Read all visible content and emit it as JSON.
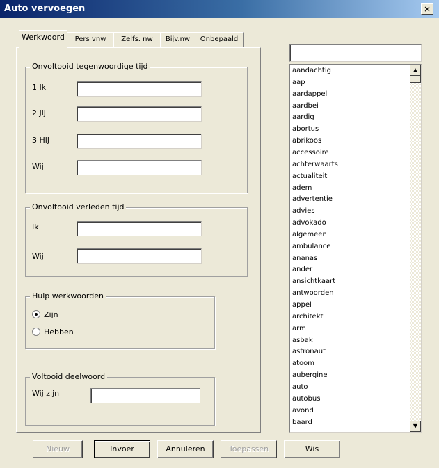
{
  "window": {
    "title": "Auto vervoegen",
    "close_glyph": "×"
  },
  "tabs": [
    {
      "label": "Werkwoord"
    },
    {
      "label": "Pers vnw"
    },
    {
      "label": "Zelfs. nw"
    },
    {
      "label": "Bijv.nw"
    },
    {
      "label": "Onbepaald"
    }
  ],
  "groups": {
    "present": {
      "legend": "Onvoltooid tegenwoordige tijd",
      "fields": [
        {
          "label": "1 Ik",
          "value": ""
        },
        {
          "label": "2 Jij",
          "value": ""
        },
        {
          "label": "3 Hij",
          "value": ""
        },
        {
          "label": "Wij",
          "value": ""
        }
      ]
    },
    "past": {
      "legend": "Onvoltooid verleden tijd",
      "fields": [
        {
          "label": "Ik",
          "value": ""
        },
        {
          "label": "Wij",
          "value": ""
        }
      ]
    },
    "aux": {
      "legend": "Hulp werkwoorden",
      "options": [
        {
          "label": "Zijn",
          "checked": true
        },
        {
          "label": "Hebben",
          "checked": false
        }
      ]
    },
    "participle": {
      "legend": "Voltooid deelwoord",
      "field": {
        "label": "Wij zijn",
        "value": ""
      }
    }
  },
  "search": {
    "value": ""
  },
  "word_list": [
    "aandachtig",
    "aap",
    "aardappel",
    "aardbei",
    "aardig",
    "abortus",
    "abrikoos",
    "accessoire",
    "achterwaarts",
    "actualiteit",
    "adem",
    "advertentie",
    "advies",
    "advokado",
    "algemeen",
    "ambulance",
    "ananas",
    "ander",
    "ansichtkaart",
    "antwoorden",
    "appel",
    "architekt",
    "arm",
    "asbak",
    "astronaut",
    "atoom",
    "aubergine",
    "auto",
    "autobus",
    "avond",
    "baard"
  ],
  "scroll": {
    "up_glyph": "▲",
    "down_glyph": "▼"
  },
  "buttons": [
    {
      "label": "Nieuw",
      "enabled": false
    },
    {
      "label": "Invoer",
      "enabled": true
    },
    {
      "label": "Annuleren",
      "enabled": true
    },
    {
      "label": "Toepassen",
      "enabled": false
    },
    {
      "label": "Wis",
      "enabled": true
    }
  ]
}
